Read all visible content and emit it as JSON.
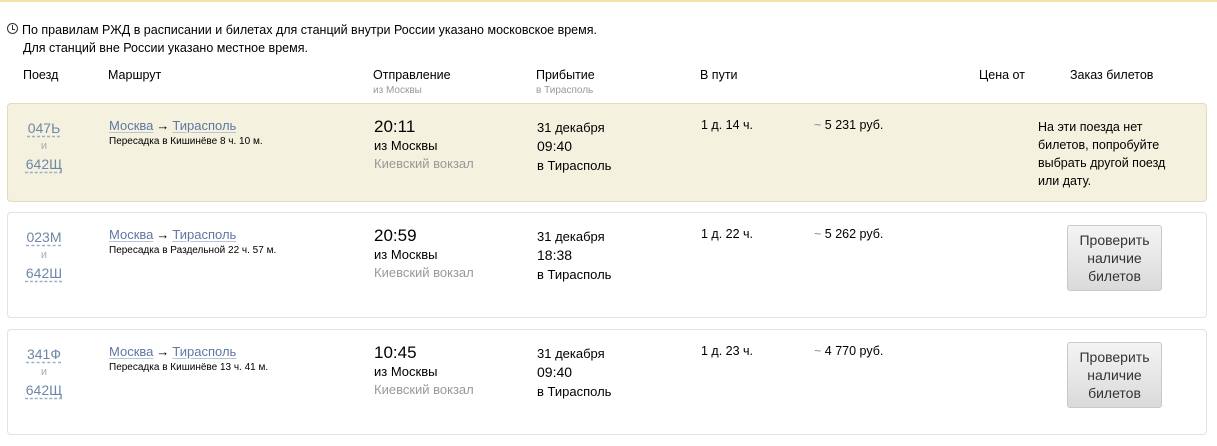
{
  "notice": {
    "line1": "По правилам РЖД в расписании и билетах для станций внутри России указано московское время.",
    "line2": "Для станций вне России указано местное время."
  },
  "columns": {
    "train": "Поезд",
    "route": "Маршрут",
    "departure": "Отправление",
    "departure_sub": "из Москвы",
    "arrival": "Прибытие",
    "arrival_sub": "в Тирасполь",
    "duration": "В пути",
    "price": "Цена от",
    "order": "Заказ билетов"
  },
  "trips": [
    {
      "train1": "047Ь",
      "joiner": "и",
      "train2": "642Щ",
      "from": "Москва",
      "arrow": "→",
      "to": "Тирасполь",
      "transfer": "Пересадка в Кишинёве 8 ч. 10 м.",
      "dep_time": "20:11",
      "dep_from": "из Москвы",
      "dep_station": "Киевский вокзал",
      "arr_date": "31 декабря",
      "arr_time": "09:40",
      "arr_to": "в Тирасполь",
      "duration": "1 д. 14 ч.",
      "price_tilde": "~",
      "price": "5 231 руб.",
      "available": false,
      "no_tickets": "На эти поезда нет билетов, попробуйте выбрать другой поезд или дату."
    },
    {
      "train1": "023М",
      "joiner": "и",
      "train2": "642Ш",
      "from": "Москва",
      "arrow": "→",
      "to": "Тирасполь",
      "transfer": "Пересадка в Раздельной 22 ч. 57 м.",
      "dep_time": "20:59",
      "dep_from": "из Москвы",
      "dep_station": "Киевский вокзал",
      "arr_date": "31 декабря",
      "arr_time": "18:38",
      "arr_to": "в Тирасполь",
      "duration": "1 д. 22 ч.",
      "price_tilde": "~",
      "price": "5 262 руб.",
      "available": true,
      "button_lines": [
        "Проверить",
        "наличие",
        "билетов"
      ]
    },
    {
      "train1": "341Ф",
      "joiner": "и",
      "train2": "642Щ",
      "from": "Москва",
      "arrow": "→",
      "to": "Тирасполь",
      "transfer": "Пересадка в Кишинёве 13 ч. 41 м.",
      "dep_time": "10:45",
      "dep_from": "из Москвы",
      "dep_station": "Киевский вокзал",
      "arr_date": "31 декабря",
      "arr_time": "09:40",
      "arr_to": "в Тирасполь",
      "duration": "1 д. 23 ч.",
      "price_tilde": "~",
      "price": "4 770 руб.",
      "available": true,
      "button_lines": [
        "Проверить",
        "наличие",
        "билетов"
      ]
    }
  ]
}
